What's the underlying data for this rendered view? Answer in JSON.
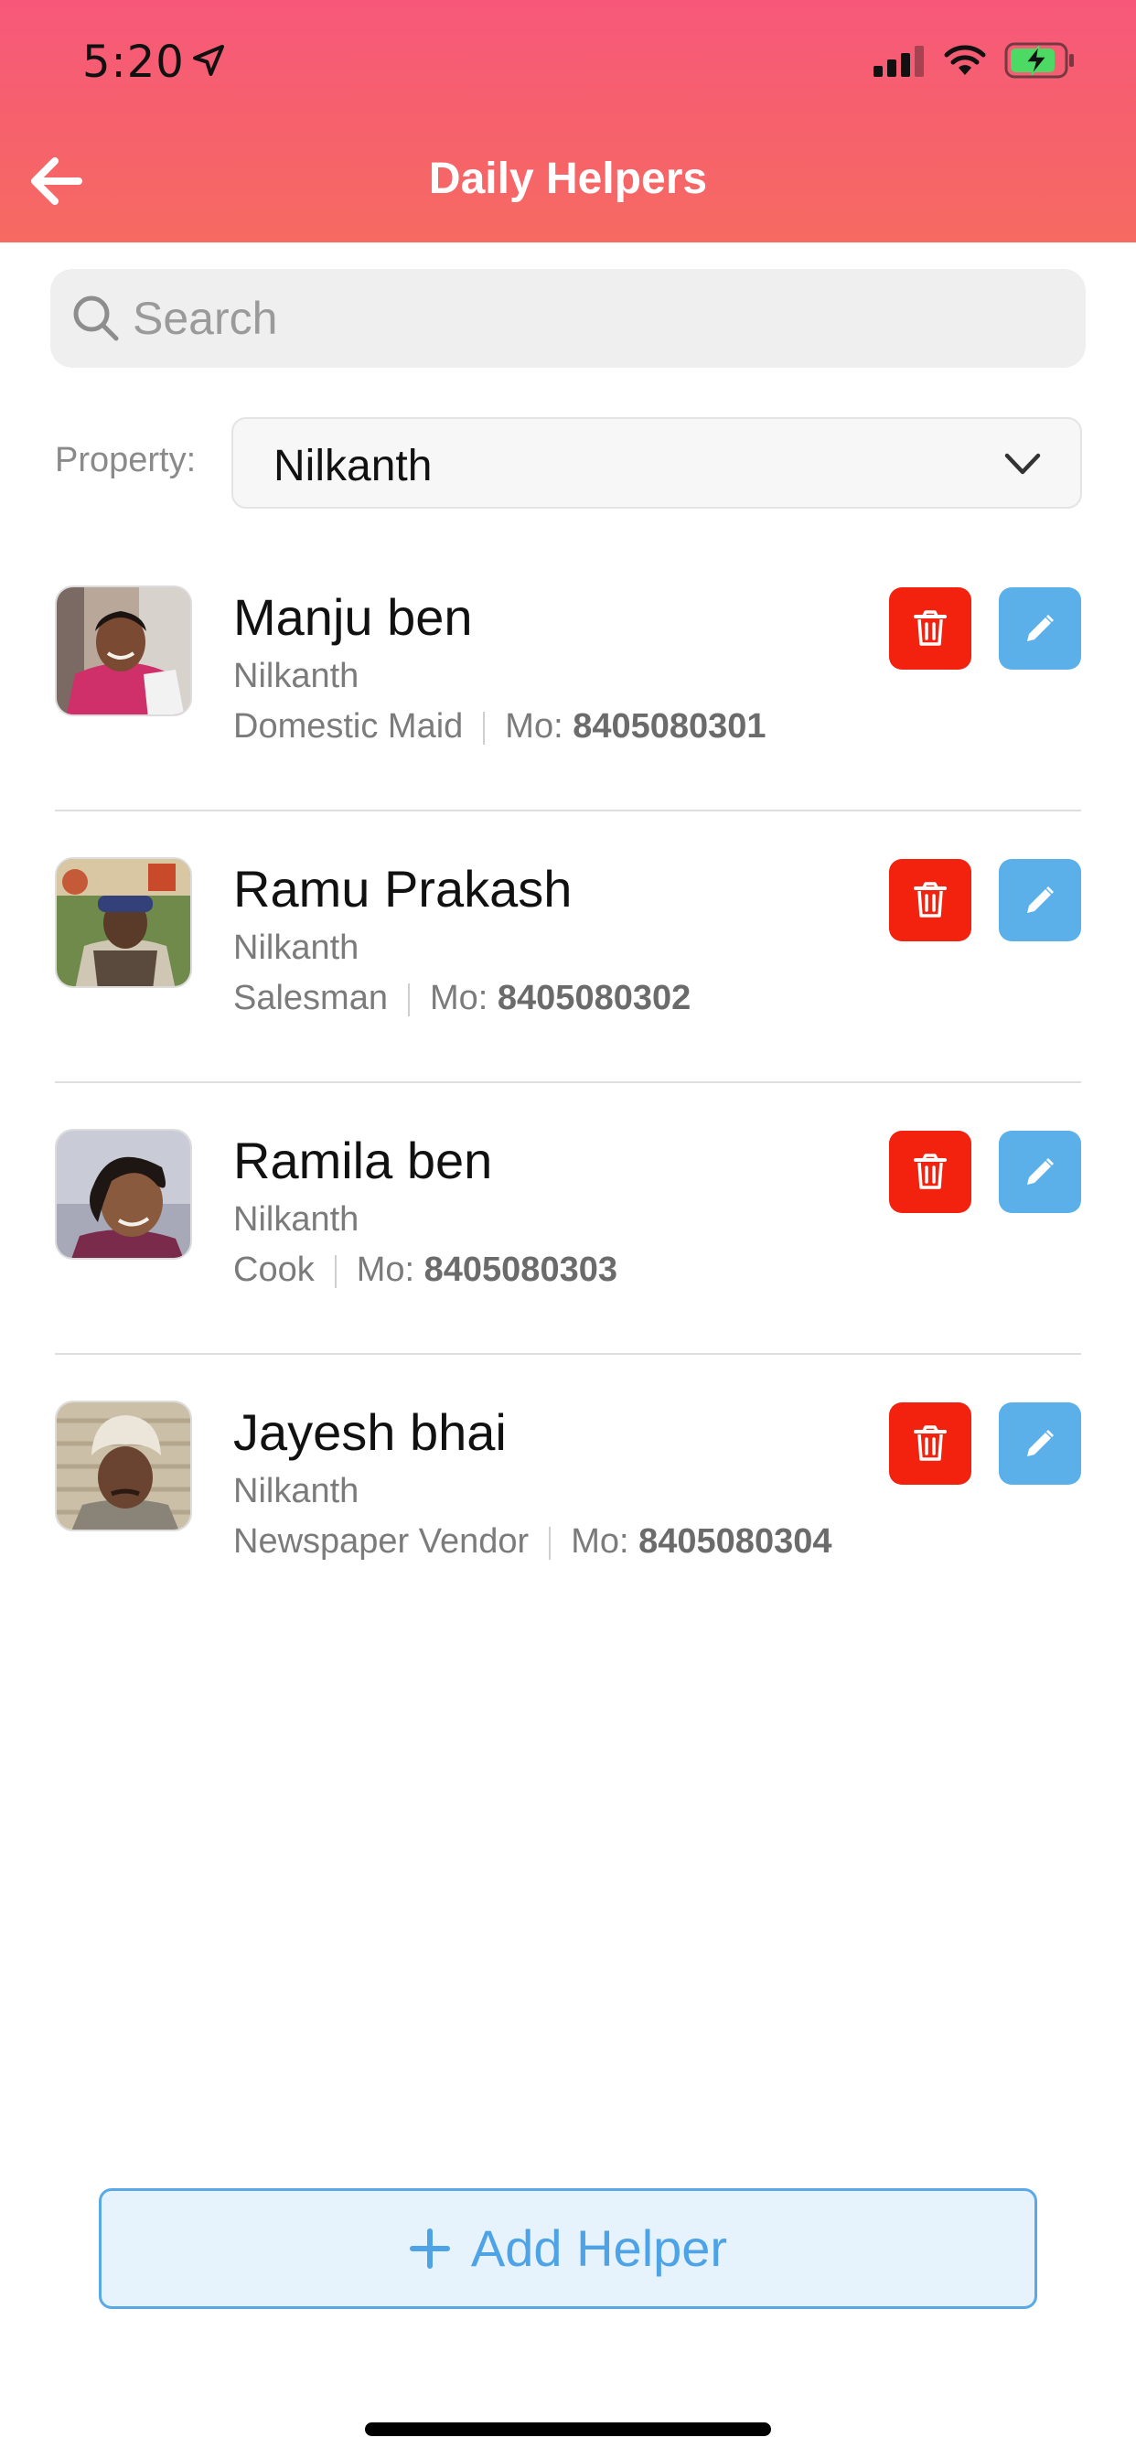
{
  "status_bar": {
    "time": "5:20"
  },
  "header": {
    "title": "Daily Helpers"
  },
  "search": {
    "placeholder": "Search",
    "value": ""
  },
  "property": {
    "label": "Property:",
    "selected": "Nilkanth"
  },
  "helpers": [
    {
      "name": "Manju ben",
      "property": "Nilkanth",
      "role": "Domestic Maid",
      "mobile_label": "Mo:",
      "mobile": "8405080301"
    },
    {
      "name": "Ramu Prakash",
      "property": "Nilkanth",
      "role": "Salesman",
      "mobile_label": "Mo:",
      "mobile": "8405080302"
    },
    {
      "name": "Ramila ben",
      "property": "Nilkanth",
      "role": "Cook",
      "mobile_label": "Mo:",
      "mobile": "8405080303"
    },
    {
      "name": "Jayesh bhai",
      "property": "Nilkanth",
      "role": "Newspaper Vendor",
      "mobile_label": "Mo:",
      "mobile": "8405080304"
    }
  ],
  "add_button": {
    "label": "Add Helper"
  },
  "colors": {
    "header_gradient_top": "#f7587a",
    "header_gradient_bottom": "#f66a62",
    "delete": "#f2220f",
    "edit": "#5bb0ea",
    "accent": "#4ea3e6"
  },
  "icons": [
    "back-arrow-icon",
    "location-arrow-icon",
    "signal-icon",
    "wifi-icon",
    "battery-charging-icon",
    "search-icon",
    "chevron-down-icon",
    "trash-icon",
    "pencil-icon",
    "plus-icon"
  ]
}
